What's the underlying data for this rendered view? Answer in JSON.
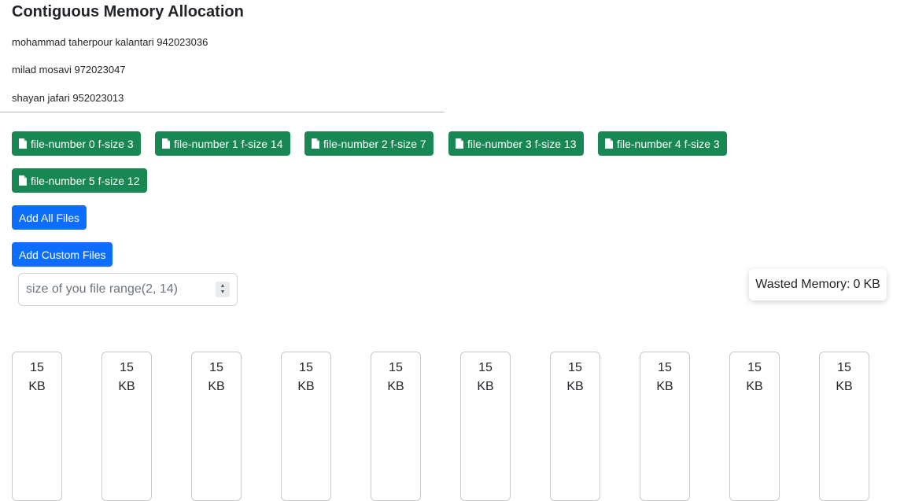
{
  "header": {
    "title": "Contiguous Memory Allocation",
    "authors": [
      "mohammad taherpour kalantari 942023036",
      "milad mosavi 972023047",
      "shayan jafari 952023013"
    ]
  },
  "files": [
    {
      "label": "file-number 0 f-size 3"
    },
    {
      "label": "file-number 1 f-size 14"
    },
    {
      "label": "file-number 2 f-size 7"
    },
    {
      "label": "file-number 3 f-size 13"
    },
    {
      "label": "file-number 4 f-size 3"
    },
    {
      "label": "file-number 5 f-size 12"
    }
  ],
  "actions": {
    "add_all_label": "Add All Files",
    "add_custom_label": "Add Custom Files"
  },
  "size_input": {
    "placeholder": "size of you file range(2, 14)",
    "value": ""
  },
  "wasted": {
    "label": "Wasted Memory:",
    "value": "0",
    "unit": "KB"
  },
  "blocks": [
    {
      "size": "15",
      "unit": "KB"
    },
    {
      "size": "15",
      "unit": "KB"
    },
    {
      "size": "15",
      "unit": "KB"
    },
    {
      "size": "15",
      "unit": "KB"
    },
    {
      "size": "15",
      "unit": "KB"
    },
    {
      "size": "15",
      "unit": "KB"
    },
    {
      "size": "15",
      "unit": "KB"
    },
    {
      "size": "15",
      "unit": "KB"
    },
    {
      "size": "15",
      "unit": "KB"
    },
    {
      "size": "15",
      "unit": "KB"
    }
  ],
  "colors": {
    "file_button": "#198754",
    "primary_button": "#0d6efd"
  },
  "icons": {
    "file_button_icon": "file-icon"
  }
}
